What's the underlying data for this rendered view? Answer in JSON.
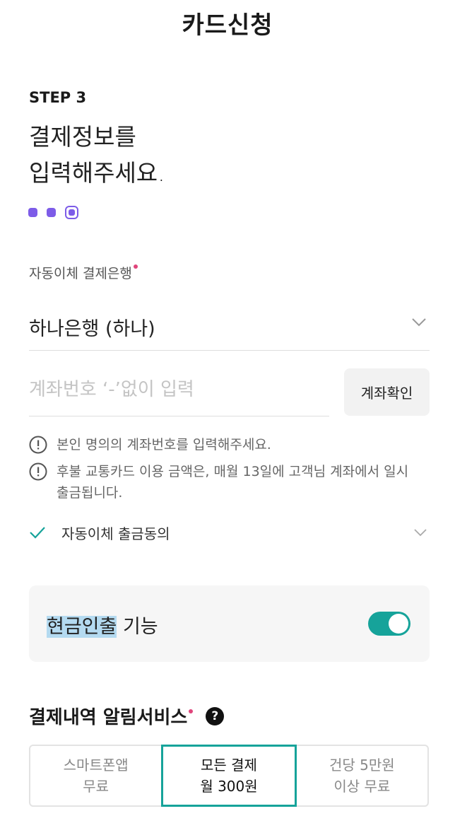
{
  "header": {
    "title": "카드신청"
  },
  "step": {
    "label": "STEP 3",
    "headline_line1": "결제정보를",
    "headline_line2": "입력해주세요.",
    "progress": {
      "total": 3,
      "current": 3
    }
  },
  "bank_field": {
    "label": "자동이체 결제은행",
    "selected_value": "하나은행 (하나)",
    "required_color": "#e0457b"
  },
  "account_field": {
    "placeholder": "계좌번호 ‘-’없이 입력",
    "value": "",
    "confirm_button": "계좌확인"
  },
  "notices": [
    {
      "icon": "alert-circle-icon",
      "text": "본인 명의의 계좌번호를 입력해주세요."
    },
    {
      "icon": "alert-circle-icon",
      "text": "후불 교통카드 이용 금액은, 매월 13일에 고객님 계좌에서 일시 출금됩니다."
    }
  ],
  "agreement": {
    "label": "자동이체 출금동의",
    "checked": true
  },
  "cash_withdrawal": {
    "label_highlight": "현금인출",
    "label_rest": " 기능",
    "enabled": true,
    "accent": "#16a39a"
  },
  "notify_service": {
    "title": "결제내역 알림서비스",
    "help_icon": "?",
    "options": [
      {
        "line1": "스마트폰앱",
        "line2": "무료",
        "selected": false
      },
      {
        "line1": "모든 결제",
        "line2": "월 300원",
        "selected": true
      },
      {
        "line1": "건당 5만원",
        "line2": "이상 무료",
        "selected": false
      }
    ]
  },
  "colors": {
    "accent_purple": "#7d5ce8",
    "accent_teal": "#16a39a"
  }
}
